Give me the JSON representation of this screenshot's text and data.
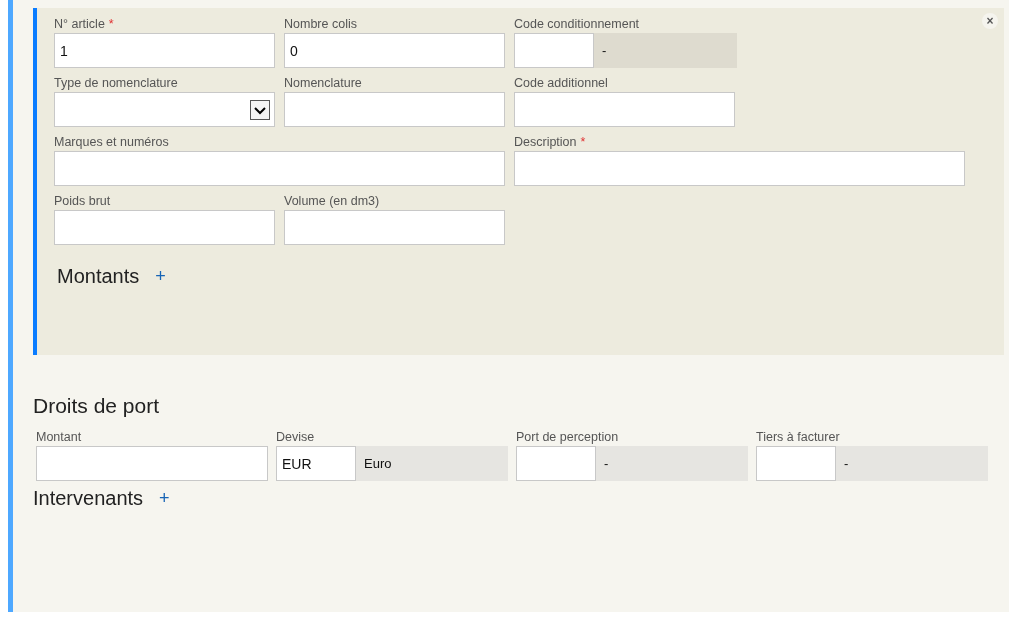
{
  "article": {
    "close": "×",
    "fields": [
      {
        "kind": "text",
        "label": "N° article",
        "required_mark": "*",
        "value": "1"
      },
      {
        "kind": "text",
        "label": "Nombre colis",
        "value": "0"
      },
      {
        "kind": "lookup",
        "label": "Code conditionnement",
        "description": "-"
      },
      {
        "kind": "select",
        "label": "Type de nomenclature"
      },
      {
        "kind": "text",
        "label": "Nomenclature"
      },
      {
        "kind": "text",
        "label": "Code additionnel"
      },
      {
        "kind": "wide",
        "label": "Marques et numéros"
      },
      {
        "kind": "wide",
        "label": "Description",
        "required_mark": "*"
      },
      {
        "kind": "text",
        "label": "Poids brut"
      },
      {
        "kind": "text",
        "label": "Volume (en dm3)"
      }
    ],
    "amounts": {
      "title": "Montants",
      "add": "+"
    }
  },
  "port_fees": {
    "title": "Droits de port",
    "fields": [
      {
        "kind": "text",
        "label": "Montant"
      },
      {
        "kind": "lookup",
        "label": "Devise",
        "value": "EUR",
        "description": "Euro"
      },
      {
        "kind": "lookup",
        "label": "Port de perception",
        "description": "-"
      },
      {
        "kind": "lookup",
        "label": "Tiers à facturer",
        "description": "-"
      }
    ]
  },
  "participants": {
    "title": "Intervenants",
    "add": "+"
  }
}
